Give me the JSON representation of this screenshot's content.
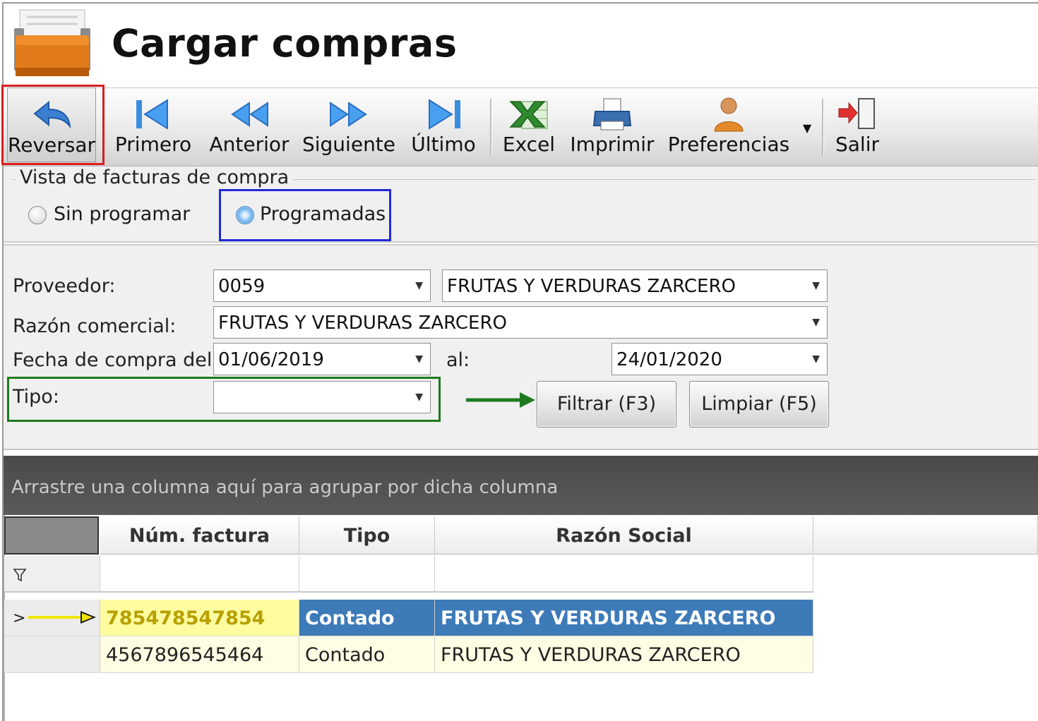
{
  "header": {
    "title": "Cargar compras"
  },
  "toolbar": {
    "reversar": "Reversar",
    "primero": "Primero",
    "anterior": "Anterior",
    "siguiente": "Siguiente",
    "ultimo": "Último",
    "excel": "Excel",
    "imprimir": "Imprimir",
    "preferencias": "Preferencias",
    "salir": "Salir",
    "icons": [
      "undo-arrow-icon",
      "first-record-icon",
      "previous-icon",
      "next-icon",
      "last-record-icon",
      "excel-icon",
      "printer-icon",
      "user-preferences-icon",
      "exit-door-icon"
    ]
  },
  "vista": {
    "legend": "Vista de facturas de compra",
    "options": [
      {
        "label": "Sin programar",
        "selected": false
      },
      {
        "label": "Programadas",
        "selected": true
      }
    ]
  },
  "filters": {
    "proveedor_label": "Proveedor:",
    "proveedor_code": "0059",
    "proveedor_name": "FRUTAS Y VERDURAS ZARCERO",
    "razon_label": "Razón comercial:",
    "razon_value": "FRUTAS Y VERDURAS ZARCERO",
    "fecha_label": "Fecha de compra del:",
    "fecha_del": "01/06/2019",
    "al_label": "al:",
    "fecha_al": "24/01/2020",
    "tipo_label": "Tipo:",
    "tipo_value": "",
    "filtrar": "Filtrar (F3)",
    "limpiar": "Limpiar (F5)"
  },
  "grid": {
    "group_hint": "Arrastre una columna aquí para agrupar por dicha columna",
    "columns": [
      "Núm. factura",
      "Tipo",
      "Razón Social"
    ],
    "rows": [
      {
        "num": "785478547854",
        "tipo": "Contado",
        "razon": "FRUTAS Y VERDURAS ZARCERO",
        "selected": true
      },
      {
        "num": "4567896545464",
        "tipo": "Contado",
        "razon": "FRUTAS Y VERDURAS ZARCERO",
        "selected": false
      }
    ]
  },
  "colors": {
    "highlight_red": "#d81e1e",
    "highlight_blue": "#1f2bd6",
    "highlight_green": "#1f7a1f",
    "selected_row": "#3d7ab8",
    "active_cell": "#fffca0"
  }
}
